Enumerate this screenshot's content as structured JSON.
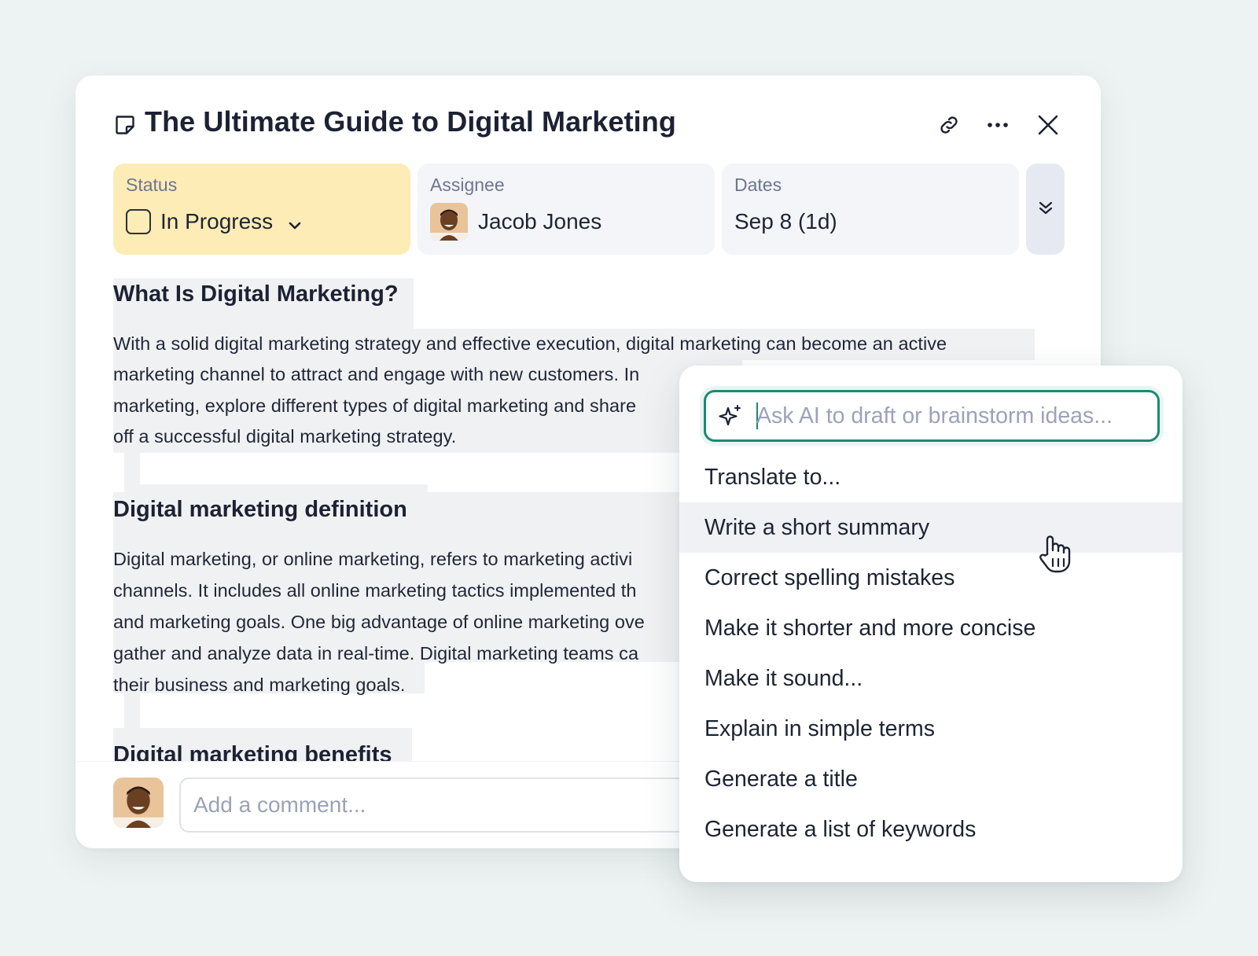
{
  "task": {
    "title": "The Ultimate Guide to Digital Marketing",
    "fields": {
      "status": {
        "label": "Status",
        "value": "In Progress"
      },
      "assignee": {
        "label": "Assignee",
        "value": "Jacob Jones"
      },
      "dates": {
        "label": "Dates",
        "value": "Sep 8 (1d)"
      }
    },
    "content": {
      "h1": "What Is Digital Marketing?",
      "p1": [
        "With a solid digital marketing strategy and effective execution, digital marketing can become an active",
        "marketing channel to attract and engage with new customers. In",
        "marketing, explore different types of digital marketing and share",
        "off a successful digital marketing strategy."
      ],
      "h2": "Digital marketing definition",
      "p2": [
        "Digital marketing, or online marketing, refers to marketing activi",
        "channels. It includes all online marketing tactics implemented th",
        "and marketing goals. One big advantage of online marketing ove",
        "gather and analyze data in real-time. Digital marketing teams ca",
        "their business and marketing goals."
      ],
      "h3": "Digital marketing benefits"
    },
    "comment": {
      "placeholder": "Add a comment..."
    }
  },
  "ai_menu": {
    "input_placeholder": "Ask AI to draft or brainstorm ideas...",
    "items": [
      "Translate to...",
      "Write a short summary",
      "Correct spelling mistakes",
      "Make it shorter and more concise",
      "Make it sound...",
      "Explain in simple terms",
      "Generate a title",
      "Generate a list of keywords"
    ],
    "hovered_item": "Write a short summary"
  },
  "colors": {
    "background": "#edf3f2",
    "status_field": "#fdecb5",
    "field_bg": "#f4f5f8",
    "accent_green": "#1a8a72",
    "selection": "#f0f1f3"
  },
  "icons": [
    "doc-icon",
    "link-icon",
    "more-icon",
    "close-icon",
    "checkbox-icon",
    "chevron-down-icon",
    "double-chevron-down-icon",
    "sparkle-icon",
    "hand-cursor-icon"
  ]
}
